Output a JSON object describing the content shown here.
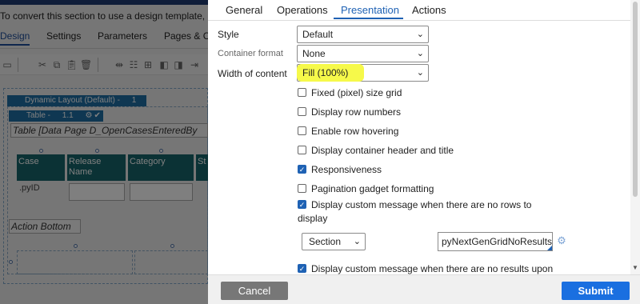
{
  "background": {
    "notice": "To convert this section to use a design template, it",
    "tabs": [
      "Design",
      "Settings",
      "Parameters",
      "Pages & C"
    ],
    "dynamic_layout_label": "Dynamic Layout (Default) -",
    "dynamic_layout_num": "1",
    "table_label": "Table -",
    "table_num": "1.1",
    "table_caption": "Table [Data Page D_OpenCasesEnteredBy",
    "columns": [
      "Case",
      "Release Name",
      "Category",
      "St"
    ],
    "cell_value": ".pyID",
    "action_caption": "Action Bottom"
  },
  "modal": {
    "tabs": [
      "General",
      "Operations",
      "Presentation",
      "Actions"
    ],
    "active_tab": "Presentation",
    "fields": {
      "style_label": "Style",
      "style_value": "Default",
      "container_format_label": "Container format",
      "container_format_value": "None",
      "width_label": "Width of content",
      "width_value": "Fill (100%)"
    },
    "checkboxes": [
      {
        "label": "Fixed (pixel) size grid",
        "checked": false
      },
      {
        "label": "Display row numbers",
        "checked": false
      },
      {
        "label": "Enable row hovering",
        "checked": false
      },
      {
        "label": "Display container header and title",
        "checked": false
      },
      {
        "label": "Responsiveness",
        "checked": true
      },
      {
        "label": "Pagination gadget formatting",
        "checked": false
      },
      {
        "label": "Display custom message when there are no rows to",
        "label_cont": "display",
        "checked": true
      },
      {
        "label": "Display custom message when there are no results upon",
        "checked": true
      }
    ],
    "message_source_select": "Section",
    "message_section_input": "pyNextGenGridNoResultsM",
    "highlight_color": "#f6f94a",
    "accent_color": "#1f62b4"
  },
  "footer": {
    "cancel_label": "Cancel",
    "submit_label": "Submit"
  }
}
